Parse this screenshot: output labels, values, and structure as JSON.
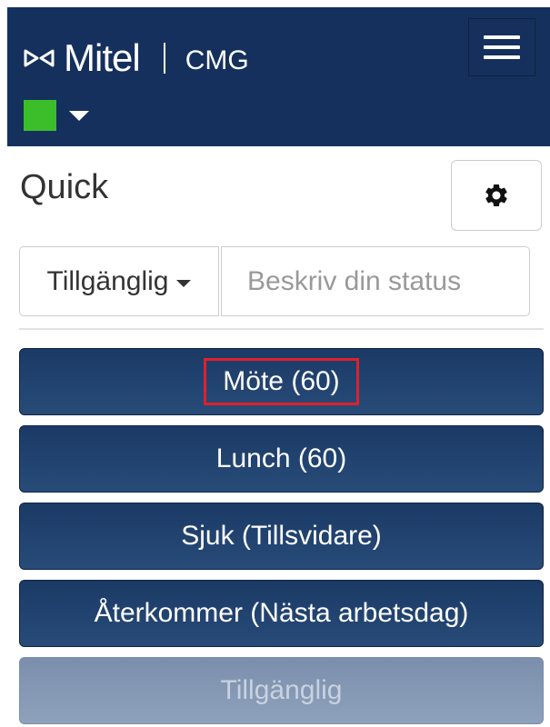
{
  "header": {
    "brand_name": "Mitel",
    "app_name": "CMG",
    "logo_icon": "mitel-logo-icon",
    "menu_icon": "hamburger-menu-icon",
    "status_color": "#3cbe2a",
    "status_caret_icon": "caret-down-icon"
  },
  "quick": {
    "title": "Quick",
    "settings_icon": "gear-icon"
  },
  "status": {
    "selected": "Tillgänglig",
    "input_placeholder": "Beskriv din status",
    "input_value": ""
  },
  "quick_buttons": [
    {
      "label": "Möte (60)",
      "highlighted": true,
      "disabled": false
    },
    {
      "label": "Lunch (60)",
      "highlighted": false,
      "disabled": false
    },
    {
      "label": "Sjuk (Tillsvidare)",
      "highlighted": false,
      "disabled": false
    },
    {
      "label": "Återkommer (Nästa arbetsdag)",
      "highlighted": false,
      "disabled": false
    },
    {
      "label": "Tillgänglig",
      "highlighted": false,
      "disabled": true
    }
  ],
  "colors": {
    "navbar": "#15305c",
    "button": "#1b3a66",
    "button_disabled": "#7b8fad",
    "highlight": "#e0202a"
  }
}
